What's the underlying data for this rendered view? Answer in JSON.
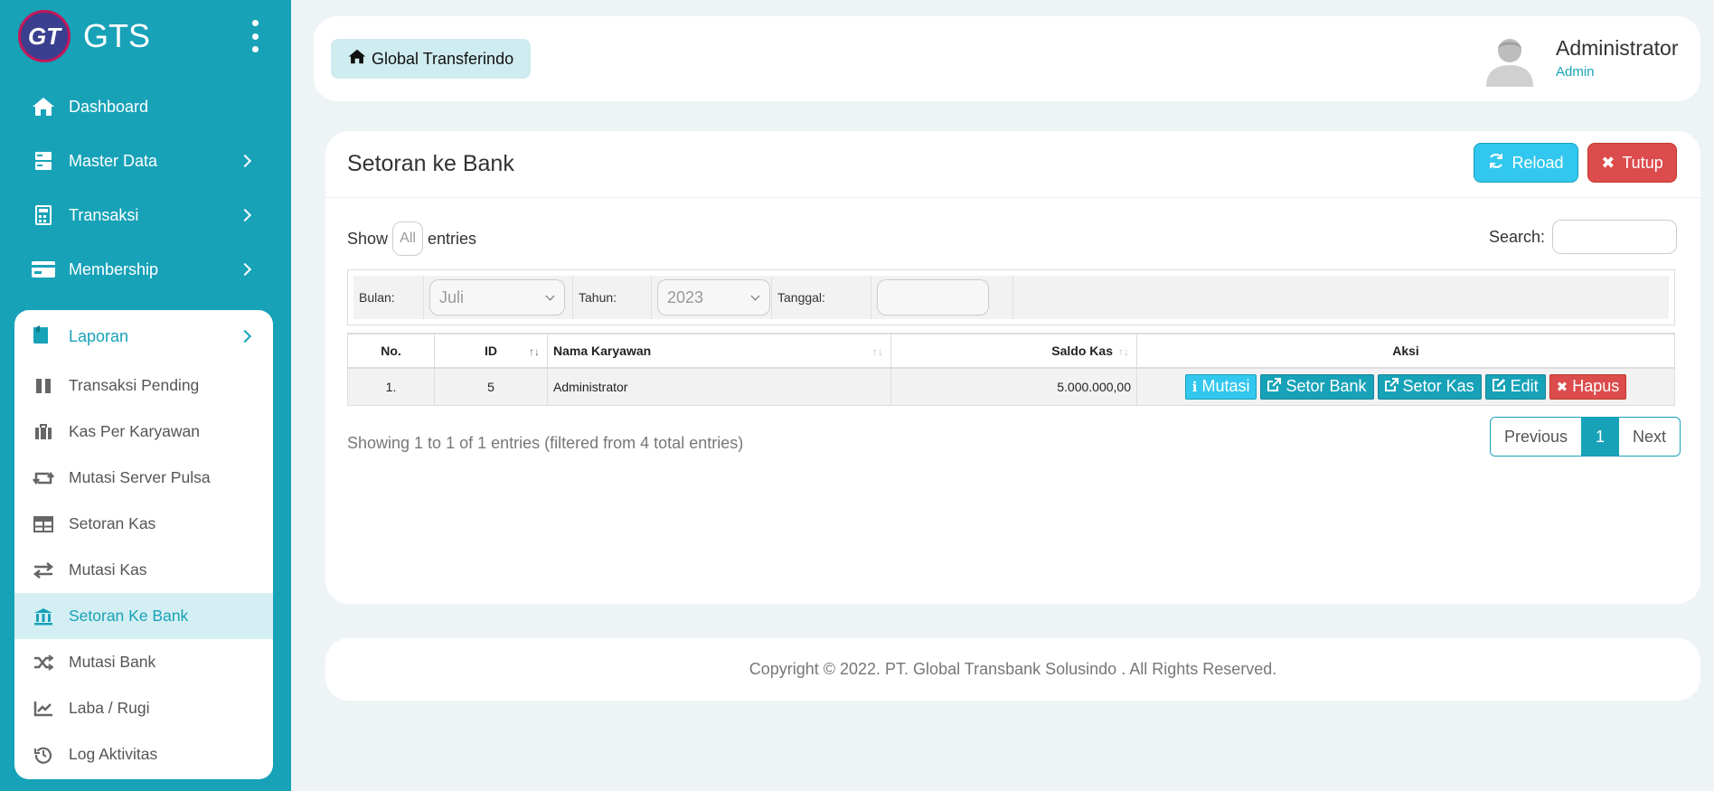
{
  "brand": {
    "logo_text": "GT",
    "name": "GTS"
  },
  "sidebar": {
    "top_items": [
      {
        "label": "Dashboard",
        "icon": "home-icon"
      },
      {
        "label": "Master Data",
        "icon": "server-icon"
      },
      {
        "label": "Transaksi",
        "icon": "calculator-icon"
      },
      {
        "label": "Membership",
        "icon": "credit-card-icon"
      }
    ],
    "laporan": {
      "label": "Laporan",
      "icon": "book-icon",
      "items": [
        {
          "label": "Transaksi Pending",
          "icon": "pause-icon"
        },
        {
          "label": "Kas Per Karyawan",
          "icon": "briefcase-icon"
        },
        {
          "label": "Mutasi Server Pulsa",
          "icon": "retweet-icon"
        },
        {
          "label": "Setoran Kas",
          "icon": "table-icon"
        },
        {
          "label": "Mutasi Kas",
          "icon": "exchange-icon"
        },
        {
          "label": "Setoran Ke Bank",
          "icon": "bank-icon",
          "active": true
        },
        {
          "label": "Mutasi Bank",
          "icon": "shuffle-icon"
        },
        {
          "label": "Laba / Rugi",
          "icon": "line-chart-icon"
        },
        {
          "label": "Log Aktivitas",
          "icon": "history-icon"
        }
      ]
    }
  },
  "header": {
    "breadcrumb": "Global Transferindo",
    "user_name": "Administrator",
    "user_role": "Admin"
  },
  "card": {
    "title": "Setoran ke Bank",
    "reload_label": "Reload",
    "close_label": "Tutup"
  },
  "table_controls": {
    "show_label": "Show",
    "length_value": "All",
    "entries_label": "entries",
    "search_label": "Search:",
    "search_value": ""
  },
  "filters": {
    "bulan_label": "Bulan:",
    "bulan_value": "Juli",
    "tahun_label": "Tahun:",
    "tahun_value": "2023",
    "tanggal_label": "Tanggal:",
    "tanggal_value": ""
  },
  "table": {
    "columns": [
      "No.",
      "ID",
      "Nama Karyawan",
      "Saldo Kas",
      "Aksi"
    ],
    "rows": [
      {
        "no": "1.",
        "id": "5",
        "nama": "Administrator",
        "saldo": "5.000.000,00"
      }
    ],
    "actions": {
      "mutasi": "Mutasi",
      "setor_bank": "Setor Bank",
      "setor_kas": "Setor Kas",
      "edit": "Edit",
      "hapus": "Hapus"
    }
  },
  "pagination": {
    "info": "Showing 1 to 1 of 1 entries (filtered from 4 total entries)",
    "previous": "Previous",
    "current": "1",
    "next": "Next"
  },
  "footer": {
    "text": "Copyright © 2022. PT. Global Transbank Solusindo . All Rights Reserved."
  },
  "colors": {
    "accent": "#17a2b8",
    "info": "#32c7ee",
    "danger": "#dc4c4c",
    "background": "#eef4f6"
  }
}
